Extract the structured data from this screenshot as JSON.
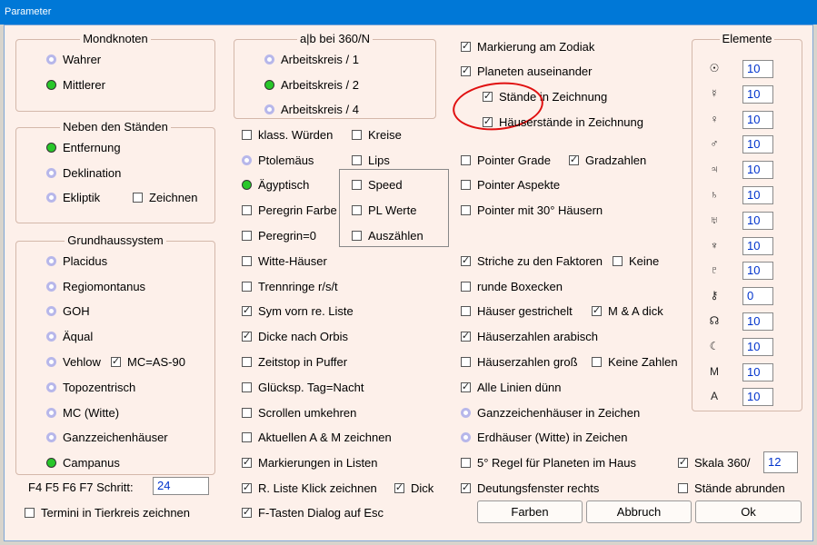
{
  "window": {
    "title": "Parameter"
  },
  "mondknoten": {
    "title": "Mondknoten",
    "wahrer": "Wahrer",
    "mittlerer": "Mittlerer"
  },
  "neben": {
    "title": "Neben den Ständen",
    "entfernung": "Entfernung",
    "deklination": "Deklination",
    "ekliptik": "Ekliptik",
    "zeichnen": "Zeichnen"
  },
  "grundhaus": {
    "title": "Grundhaussystem",
    "placidus": "Placidus",
    "regiomontanus": "Regiomontanus",
    "goh": "GOH",
    "aqual": "Äqual",
    "vehlow": "Vehlow",
    "mc_as": "MC=AS-90",
    "topozentrisch": "Topozentrisch",
    "mc_witte": "MC (Witte)",
    "ganzzeichen": "Ganzzeichenhäuser",
    "campanus": "Campanus"
  },
  "schritt": {
    "label": "F4 F5 F6 F7 Schritt:",
    "value": "24"
  },
  "termini": "Termini in Tierkreis zeichnen",
  "ab360": {
    "title": "a|b bei 360/N",
    "k1": "Arbeitskreis / 1",
    "k2": "Arbeitskreis / 2",
    "k4": "Arbeitskreis / 4"
  },
  "col2": {
    "klass": "klass. Würden",
    "kreise": "Kreise",
    "ptolemaus": "Ptolemäus",
    "lips": "Lips",
    "agyptisch": "Ägyptisch",
    "speed": "Speed",
    "peregrin_farbe": "Peregrin Farbe",
    "pl_werte": "PL Werte",
    "peregrin0": "Peregrin=0",
    "auszahlen": "Auszählen",
    "witte": "Witte-Häuser",
    "trennringe": "Trennringe  r/s/t",
    "sym_vorn": "Sym vorn re. Liste",
    "dicke": "Dicke nach Orbis",
    "zeitstop": "Zeitstop in Puffer",
    "glucksp": "Glücksp. Tag=Nacht",
    "scrollen": "Scrollen umkehren",
    "aktuellen": "Aktuellen A & M zeichnen",
    "markierungen": "Markierungen in Listen",
    "rliste": "R. Liste Klick zeichnen",
    "dick": "Dick",
    "ftasten": "F-Tasten Dialog auf Esc"
  },
  "col3": {
    "markierung": "Markierung am Zodiak",
    "planeten": "Planeten auseinander",
    "stande": "Stände in Zeichnung",
    "hauserstande": "Häuserstände in Zeichnung",
    "pointer_grade": "Pointer Grade",
    "gradzahlen": "Gradzahlen",
    "pointer_aspekte": "Pointer Aspekte",
    "pointer30": "Pointer mit 30° Häusern",
    "striche": "Striche zu den Faktoren",
    "keine": "Keine",
    "runde": "runde Boxecken",
    "hauser_gestrichelt": "Häuser gestrichelt",
    "ma_dick": "M & A dick",
    "hauserzahlen_arabisch": "Häuserzahlen arabisch",
    "hauserzahlen_gross": "Häuserzahlen groß",
    "keine_zahlen": "Keine Zahlen",
    "alle_linien": "Alle Linien dünn",
    "ganzzeichen_zeichen": "Ganzzeichenhäuser in Zeichen",
    "erdhauser": "Erdhäuser (Witte) in Zeichen",
    "regel5": "5° Regel für Planeten im Haus",
    "deutungsfenster": "Deutungsfenster rechts",
    "skala": "Skala 360/",
    "skala_value": "12",
    "stande_abrunden": "Stände abrunden"
  },
  "elemente": {
    "title": "Elemente",
    "rows": [
      {
        "icon": "sun-icon",
        "symbol": "☉",
        "value": "10"
      },
      {
        "icon": "mercury-icon",
        "symbol": "☿",
        "value": "10"
      },
      {
        "icon": "venus-icon",
        "symbol": "♀",
        "value": "10"
      },
      {
        "icon": "mars-icon",
        "symbol": "♂",
        "value": "10"
      },
      {
        "icon": "jupiter-icon",
        "symbol": "♃",
        "value": "10"
      },
      {
        "icon": "saturn-icon",
        "symbol": "♄",
        "value": "10"
      },
      {
        "icon": "uranus-icon",
        "symbol": "♅",
        "value": "10"
      },
      {
        "icon": "neptune-icon",
        "symbol": "♆",
        "value": "10"
      },
      {
        "icon": "pluto-icon",
        "symbol": "♇",
        "value": "10"
      },
      {
        "icon": "chiron-icon",
        "symbol": "⚷",
        "value": "0"
      },
      {
        "icon": "node-icon",
        "symbol": "☊",
        "value": "10"
      },
      {
        "icon": "moon-icon",
        "symbol": "☾",
        "value": "10"
      },
      {
        "icon": "mc-icon",
        "symbol": "M",
        "value": "10"
      },
      {
        "icon": "ac-icon",
        "symbol": "A",
        "value": "10"
      }
    ]
  },
  "buttons": {
    "farben": "Farben",
    "abbruch": "Abbruch",
    "ok": "Ok"
  }
}
